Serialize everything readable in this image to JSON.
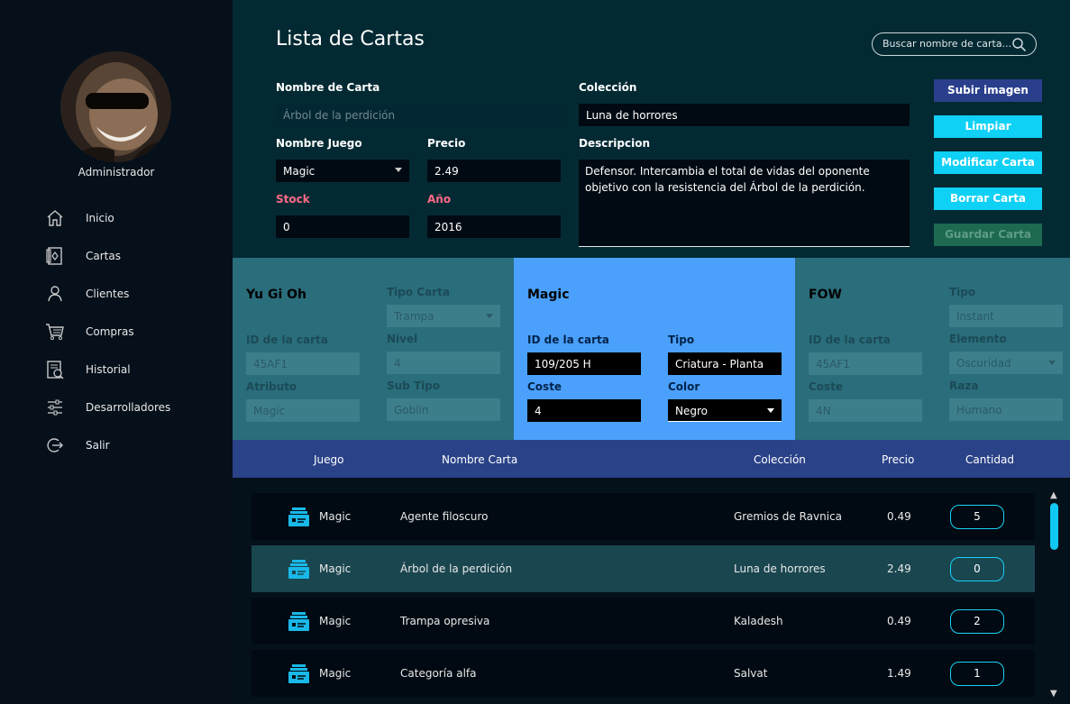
{
  "sidebar": {
    "admin_name": "Administrador",
    "items": [
      {
        "label": "Inicio",
        "icon": "home-icon"
      },
      {
        "label": "Cartas",
        "icon": "cards-icon"
      },
      {
        "label": "Clientes",
        "icon": "user-icon"
      },
      {
        "label": "Compras",
        "icon": "cart-icon"
      },
      {
        "label": "Historial",
        "icon": "history-icon"
      },
      {
        "label": "Desarrolladores",
        "icon": "sliders-icon"
      },
      {
        "label": "Salir",
        "icon": "logout-icon"
      }
    ]
  },
  "header": {
    "title": "Lista de Cartas",
    "search_placeholder": "Buscar nombre de carta..."
  },
  "form": {
    "nombre_carta_label": "Nombre de Carta",
    "nombre_carta_value": "Árbol de la perdición",
    "coleccion_label": "Colección",
    "coleccion_value": "Luna de horrores",
    "nombre_juego_label": "Nombre Juego",
    "nombre_juego_value": "Magic",
    "precio_label": "Precio",
    "precio_value": "2.49",
    "descripcion_label": "Descripcion",
    "descripcion_value": "Defensor. Intercambia el total de vidas del oponente objetivo con la resistencia del Árbol de la perdición.",
    "stock_label": "Stock",
    "stock_value": "0",
    "anio_label": "Año",
    "anio_value": "2016"
  },
  "buttons": {
    "subir_imagen": "Subir imagen",
    "limpiar": "Limpiar",
    "modificar": "Modificar Carta",
    "borrar": "Borrar Carta",
    "guardar": "Guardar Carta"
  },
  "panels": {
    "yugioh": {
      "title": "Yu Gi Oh",
      "tipo_carta_label": "Tipo Carta",
      "tipo_carta_value": "Trampa",
      "id_label": "ID de la carta",
      "id_value": "45AF1",
      "nivel_label": "Nivel",
      "nivel_value": "4",
      "atributo_label": "Atributo",
      "atributo_value": "Magic",
      "sub_tipo_label": "Sub Tipo",
      "sub_tipo_value": "Goblin"
    },
    "magic": {
      "title": "Magic",
      "id_label": "ID de la carta",
      "id_value": "109/205 H",
      "tipo_label": "Tipo",
      "tipo_value": "Criatura - Planta",
      "coste_label": "Coste",
      "coste_value": "4",
      "color_label": "Color",
      "color_value": "Negro"
    },
    "fow": {
      "title": "FOW",
      "tipo_label": "Tipo",
      "tipo_value": "Instant",
      "id_label": "ID de la carta",
      "id_value": "45AF1",
      "elemento_label": "Elemento",
      "elemento_value": "Oscuridad",
      "coste_label": "Coste",
      "coste_value": "4N",
      "raza_label": "Raza",
      "raza_value": "Humano"
    }
  },
  "table": {
    "headers": {
      "juego": "Juego",
      "nombre": "Nombre Carta",
      "coleccion": "Colección",
      "precio": "Precio",
      "cantidad": "Cantidad"
    },
    "rows": [
      {
        "juego": "Magic",
        "nombre": "Agente filoscuro",
        "coleccion": "Gremios de Ravnica",
        "precio": "0.49",
        "cantidad": "5"
      },
      {
        "juego": "Magic",
        "nombre": "Árbol de la perdición",
        "coleccion": "Luna de horrores",
        "precio": "2.49",
        "cantidad": "0"
      },
      {
        "juego": "Magic",
        "nombre": "Trampa opresiva",
        "coleccion": "Kaladesh",
        "precio": "0.49",
        "cantidad": "2"
      },
      {
        "juego": "Magic",
        "nombre": "Categoría alfa",
        "coleccion": "Salvat",
        "precio": "1.49",
        "cantidad": "1"
      }
    ]
  },
  "colors": {
    "accent": "#0fd0f5",
    "navy": "#2a4288",
    "panel_teal": "#2a6d7b",
    "panel_selected": "#4aa0fb",
    "warning_label": "#ff6a86"
  }
}
